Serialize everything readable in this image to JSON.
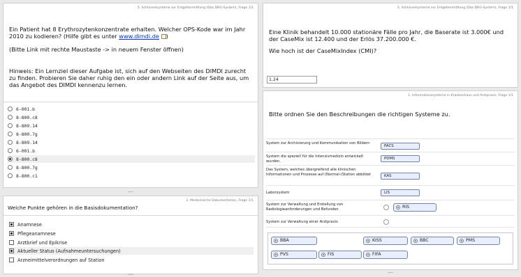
{
  "q1": {
    "header": "5. Schlüsselsysteme zur Entgeltermittlung (Das DRG-System), Frage 1/1",
    "question_pre": "Ein Patient hat 8 Erythrozytenkonzentrate erhalten. Welcher OPS-Kode war im Jahr 2010 zu kodieren? (Hilfe gibt es unter ",
    "link": "www.dimdi.de",
    "question_post": ")",
    "note": "(Bitte Link mit rechte Maustaste -> in neuem Fenster öffnen)",
    "hint": "Hinweis: Ein Lernziel dieser Aufgabe ist, sich auf den Webseiten des DIMDI zurecht zu finden. Probieren Sie daher ruhig den ein oder andern Link auf der Seite aus, um das Angebot des DIMDI kennenzu lernen.",
    "options": [
      {
        "label": "6-001.b",
        "selected": false
      },
      {
        "label": "8-800.c8",
        "selected": false
      },
      {
        "label": "8-809.14",
        "selected": false
      },
      {
        "label": "8-800.7g",
        "selected": false
      },
      {
        "label": "8-809.14",
        "selected": false
      },
      {
        "label": "6-001.b",
        "selected": false
      },
      {
        "label": "8-800.c8",
        "selected": true
      },
      {
        "label": "8-800.7g",
        "selected": false
      },
      {
        "label": "8-800.c1",
        "selected": false
      }
    ]
  },
  "q2": {
    "header": "5. Schlüsselsysteme zur Entgeltermittlung (Das DRG-System), Frage 1/1",
    "question": "Eine Klinik behandelt 10.000 stationäre Fälle pro Jahr, die Baserate ist 3.000€ und der CaseMix ist 12.400 und der Erlös 37.200.000 €.",
    "question2": "Wie hoch ist der CaseMixIndex (CMI)?",
    "answer": "1.24"
  },
  "q3": {
    "header": "3. Medizinische Dokumentation, Frage 1/1",
    "question": "Welche Punkte gehören in die Basisdokumentation?",
    "options": [
      {
        "label": "Anamnese",
        "checked": true
      },
      {
        "label": "Pflegeanamnese",
        "checked": true
      },
      {
        "label": "Arztbrief und Epikrise",
        "checked": false
      },
      {
        "label": "Aktueller Status (Aufnahmeuntersuchungen)",
        "checked": true
      },
      {
        "label": "Arzneimittelverordnungen auf Station",
        "checked": false
      }
    ]
  },
  "q4": {
    "header": "1. Informationssysteme in Krankenhaus und Arztpraxis, Frage 1/1",
    "question": "Bitte ordnen Sie den Beschreibungen die richtigen Systeme zu.",
    "rows": [
      {
        "desc": "System zur Archivierung und Kommunikation von Bildern",
        "answer": "PACS"
      },
      {
        "desc": "System die speziell für die Intensivmedizin entwickelt wurden.",
        "answer": "PDMS"
      },
      {
        "desc": "Das System, welches übergreifend alle klinischen Informationen und Prozesse auf (Normal-)Station abbildet",
        "answer": "KAS"
      },
      {
        "desc": "Laborsystem",
        "answer": "LIS"
      },
      {
        "desc": "System zur Verwaltung und Erstellung von Radiologieanforderungen und Befunden",
        "answer": "RIS"
      },
      {
        "desc": "System zur Verwaltung einer Arztpraxis",
        "answer": ""
      }
    ],
    "pool": [
      "BBA",
      "KISS",
      "BBC",
      "PMS",
      "PVS",
      "FIS",
      "FIFA"
    ]
  }
}
